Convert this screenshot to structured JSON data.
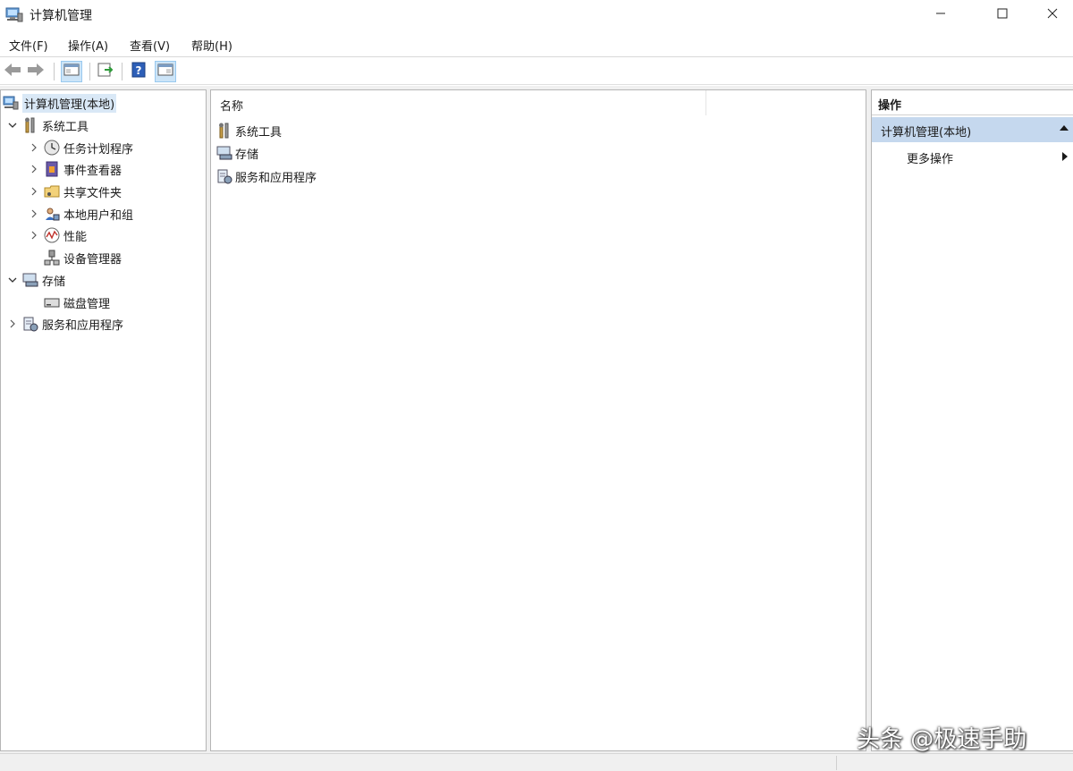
{
  "window": {
    "title": "计算机管理",
    "buttons": {
      "minimize": "minimize-icon",
      "maximize": "maximize-icon",
      "close": "close-icon"
    }
  },
  "menu": {
    "items": [
      "文件(F)",
      "操作(A)",
      "查看(V)",
      "帮助(H)"
    ]
  },
  "toolbar": {
    "icons": [
      "back-arrow-icon",
      "forward-arrow-icon",
      "show-hide-console-tree-icon",
      "export-list-icon",
      "help-icon",
      "show-hide-action-pane-icon"
    ]
  },
  "tree": {
    "root": "计算机管理(本地)",
    "items": [
      {
        "label": "系统工具",
        "level": 1,
        "expanded": true,
        "icon": "tools-icon"
      },
      {
        "label": "任务计划程序",
        "level": 2,
        "expanded": false,
        "icon": "clock-icon"
      },
      {
        "label": "事件查看器",
        "level": 2,
        "expanded": false,
        "icon": "event-viewer-icon"
      },
      {
        "label": "共享文件夹",
        "level": 2,
        "expanded": false,
        "icon": "shared-folder-icon"
      },
      {
        "label": "本地用户和组",
        "level": 2,
        "expanded": false,
        "icon": "users-icon"
      },
      {
        "label": "性能",
        "level": 2,
        "expanded": false,
        "icon": "performance-icon"
      },
      {
        "label": "设备管理器",
        "level": 2,
        "leaf": true,
        "icon": "device-manager-icon"
      },
      {
        "label": "存储",
        "level": 1,
        "expanded": true,
        "icon": "storage-icon"
      },
      {
        "label": "磁盘管理",
        "level": 2,
        "leaf": true,
        "icon": "disk-icon"
      },
      {
        "label": "服务和应用程序",
        "level": 1,
        "expanded": false,
        "icon": "services-icon"
      }
    ]
  },
  "list": {
    "column_header": "名称",
    "rows": [
      "系统工具",
      "存储",
      "服务和应用程序"
    ]
  },
  "actions": {
    "title": "操作",
    "group": "计算机管理(本地)",
    "items": [
      "更多操作"
    ]
  },
  "watermark": "头条 @极速手助",
  "colors": {
    "selection": "#d9e8f6",
    "action_group": "#c5d8ee",
    "pane_border": "#b5b5b5",
    "workspace": "#f0f0f0"
  }
}
